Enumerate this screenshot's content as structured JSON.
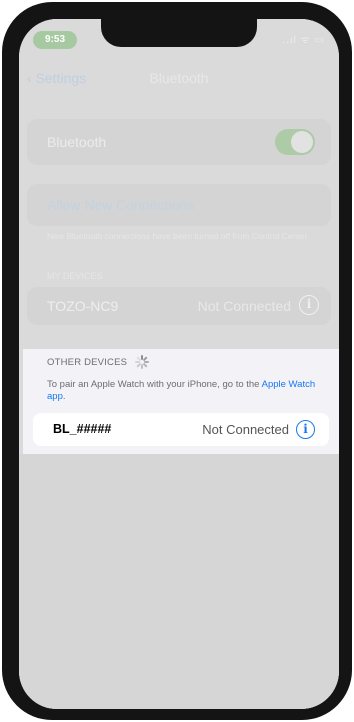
{
  "status_bar": {
    "time": "9:53",
    "icons": "..ıl ᯤ ▭",
    "time_pill_color": "#a6c9a2"
  },
  "nav": {
    "back_label": "Settings",
    "back_icon": "chevron-left-icon",
    "title": "Bluetooth"
  },
  "bluetooth": {
    "label": "Bluetooth",
    "toggle_on": true
  },
  "allow": {
    "label": "Allow New Connections",
    "note": "New Bluetooth connections have been turned off from Control Center."
  },
  "my_devices": {
    "header": "MY DEVICES",
    "items": [
      {
        "name": "TOZO-NC9",
        "status": "Not Connected",
        "info_icon": "info-icon"
      }
    ]
  },
  "other_devices": {
    "header": "OTHER DEVICES",
    "spinner_icon": "loading-spinner-icon",
    "pair_text": "To pair an Apple Watch with your iPhone, go to the",
    "pair_link": "Apple Watch app",
    "pair_end": ".",
    "items": [
      {
        "name": "BL_#####",
        "status": "Not Connected",
        "info_icon": "info-icon"
      }
    ]
  },
  "colors": {
    "accent": "#1877f2",
    "dim_overlay": "#d8d8d8",
    "phone_frame": "#141414"
  }
}
